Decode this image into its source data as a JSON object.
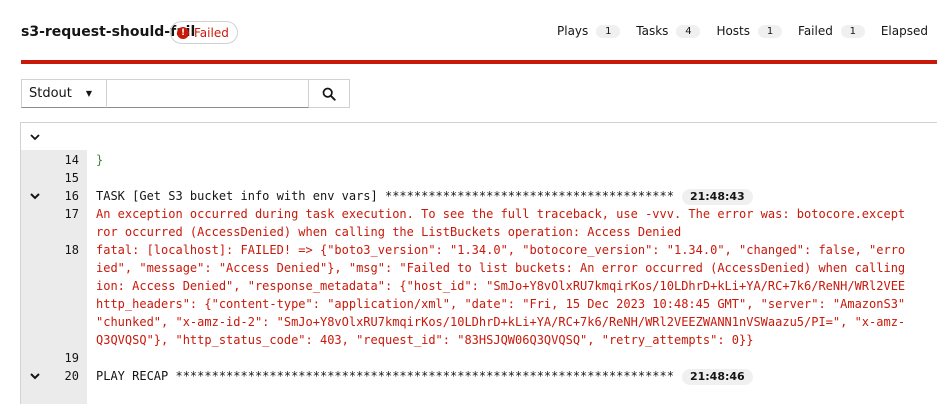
{
  "header": {
    "job_title": "s3-request-should-fail",
    "status_label": "Failed",
    "status_icon": "!",
    "stats": [
      {
        "label": "Plays",
        "value": "1"
      },
      {
        "label": "Tasks",
        "value": "4"
      },
      {
        "label": "Hosts",
        "value": "1"
      },
      {
        "label": "Failed",
        "value": "1"
      },
      {
        "label": "Elapsed",
        "value": ""
      }
    ]
  },
  "toolbar": {
    "select_value": "Stdout",
    "search_value": "",
    "search_placeholder": ""
  },
  "output": {
    "lines": [
      {
        "num": "14",
        "text": "}",
        "color": "green"
      },
      {
        "num": "15",
        "text": "",
        "color": "dark"
      },
      {
        "num": "16",
        "text": "TASK [Get S3 bucket info with env vars] ****************************************",
        "color": "dark",
        "time": "21:48:43"
      },
      {
        "num": "17",
        "text": "An exception occurred during task execution. To see the full traceback, use -vvv. The error was: botocore.except",
        "color": "red"
      },
      {
        "num": "",
        "text": "ror occurred (AccessDenied) when calling the ListBuckets operation: Access Denied",
        "color": "red"
      },
      {
        "num": "18",
        "text": "fatal: [localhost]: FAILED! => {\"boto3_version\": \"1.34.0\", \"botocore_version\": \"1.34.0\", \"changed\": false, \"erro",
        "color": "red"
      },
      {
        "num": "",
        "text": "ied\", \"message\": \"Access Denied\"}, \"msg\": \"Failed to list buckets: An error occurred (AccessDenied) when calling",
        "color": "red"
      },
      {
        "num": "",
        "text": "ion: Access Denied\", \"response_metadata\": {\"host_id\": \"SmJo+Y8vOlxRU7kmqirKos/10LDhrD+kLi+YA/RC+7k6/ReNH/WRl2VEE",
        "color": "red"
      },
      {
        "num": "",
        "text": "http_headers\": {\"content-type\": \"application/xml\", \"date\": \"Fri, 15 Dec 2023 10:48:45 GMT\", \"server\": \"AmazonS3\"",
        "color": "red"
      },
      {
        "num": "",
        "text": "\"chunked\", \"x-amz-id-2\": \"SmJo+Y8vOlxRU7kmqirKos/10LDhrD+kLi+YA/RC+7k6/ReNH/WRl2VEEZWANN1nVSWaazu5/PI=\", \"x-amz-",
        "color": "red"
      },
      {
        "num": "",
        "text": "Q3QVQSQ\"}, \"http_status_code\": 403, \"request_id\": \"83HSJQW06Q3QVQSQ\", \"retry_attempts\": 0}}",
        "color": "red"
      },
      {
        "num": "19",
        "text": "",
        "color": "dark"
      },
      {
        "num": "20",
        "text": "PLAY RECAP *********************************************************************",
        "color": "dark",
        "time": "21:48:46"
      }
    ]
  }
}
